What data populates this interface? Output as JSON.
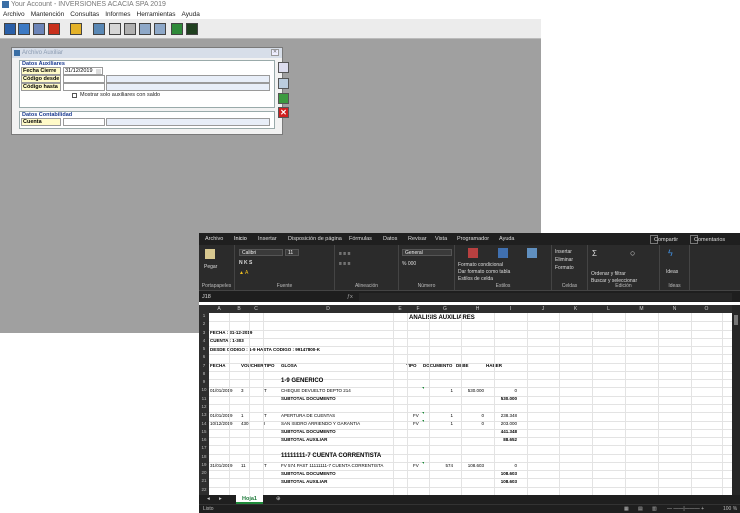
{
  "legacy_app": {
    "title": "Your Account - INVERSIONES ACACIA SPA 2019",
    "menu": [
      "Archivo",
      "Mantención",
      "Consultas",
      "Informes",
      "Herramientas",
      "Ayuda"
    ],
    "dialog": {
      "title": "Archivo Auxiliar",
      "section1_title": "Datos Auxiliares",
      "fecha_cierre_label": "Fecha Cierre",
      "fecha_cierre_value": "31/12/2019",
      "codigo_desde_label": "Código desde",
      "codigo_hasta_label": "Código hasta",
      "checkbox_label": "Mostrar solo auxiliares con saldo",
      "section2_title": "Datos Contabilidad",
      "cuenta_label": "Cuenta"
    }
  },
  "excel": {
    "tabs": [
      "Archivo",
      "Inicio",
      "Insertar",
      "Disposición de página",
      "Fórmulas",
      "Datos",
      "Revisar",
      "Vista",
      "Programador",
      "Ayuda"
    ],
    "active_tab": "Inicio",
    "share_label": "Compartir",
    "comments_label": "Comentarios",
    "ribbon": {
      "paste": "Pegar",
      "clipboard": "Portapapeles",
      "font_name": "Calibri",
      "font_size": "11",
      "font_group": "Fuente",
      "alignment_group": "Alineación",
      "number_format": "General",
      "number_group": "Número",
      "cond_format": "Formato condicional",
      "format_table": "Dar formato como tabla",
      "cell_styles": "Estilos de celda",
      "styles_group": "Estilos",
      "insert": "Insertar",
      "delete": "Eliminar",
      "format": "Formato",
      "cells_group": "Celdas",
      "sort_filter": "Ordenar y filtrar",
      "find_select": "Buscar y seleccionar",
      "edit_group": "Edición",
      "ideas": "Ideas",
      "ideas_group": "Ideas"
    },
    "name_box": "J18",
    "columns": [
      "A",
      "B",
      "C",
      "D",
      "E",
      "F",
      "G",
      "H",
      "I",
      "J",
      "K",
      "L",
      "M",
      "N",
      "O"
    ],
    "rows": [
      "1",
      "2",
      "3",
      "4",
      "5",
      "6",
      "7",
      "8",
      "9",
      "10",
      "11",
      "12",
      "13",
      "14",
      "15",
      "16",
      "17",
      "18",
      "19",
      "20",
      "21",
      "22"
    ],
    "report": {
      "title": "ANALISIS AUXILIARES",
      "fecha": "FECHA : 31-12-2019",
      "cuenta": "CUENTA : 1-303",
      "desde": "DESDE CODIGO : 1-9 HASTA CODIGO : 99147800-K",
      "headers": [
        "FECHA",
        "VOUCHER",
        "TIPO",
        "GLOSA",
        "TIPO",
        "DOCUMENTO",
        "DEBE",
        "HABER"
      ],
      "group1": "1-9 GENERICO",
      "r10": [
        "01/01/2019",
        "3",
        "T",
        "CHEQUE DEVUELTO DEPTO 214",
        "",
        "1",
        "530.000",
        "0"
      ],
      "subtotal_doc": "SUBTOTAL DOCUMENTO",
      "r11_total": "530.000",
      "r13": [
        "01/01/2019",
        "1",
        "T",
        "APERTURA DE CUENTAS",
        "FV",
        "1",
        "0",
        "238.348"
      ],
      "r14": [
        "10/12/2019",
        "430",
        "I",
        "SAN ISIDRO ARRIENDO Y GARANTIA",
        "FV",
        "1",
        "0",
        "203.000"
      ],
      "r15_total": "441.348",
      "subtotal_aux": "SUBTOTAL AUXILIAR",
      "r16_total": "88.652",
      "group2": "11111111-7 CUENTA CORRENTISTA",
      "r19": [
        "31/01/2019",
        "11",
        "T",
        "FV 574 PAST 11111111-7 CUENTA CORRENTISTA",
        "FV",
        "574",
        "108.603",
        "0"
      ],
      "r20_total": "108.603",
      "r21_total": "108.603"
    },
    "sheet_tab": "Hoja1",
    "status": "Listo",
    "zoom": "100 %"
  }
}
